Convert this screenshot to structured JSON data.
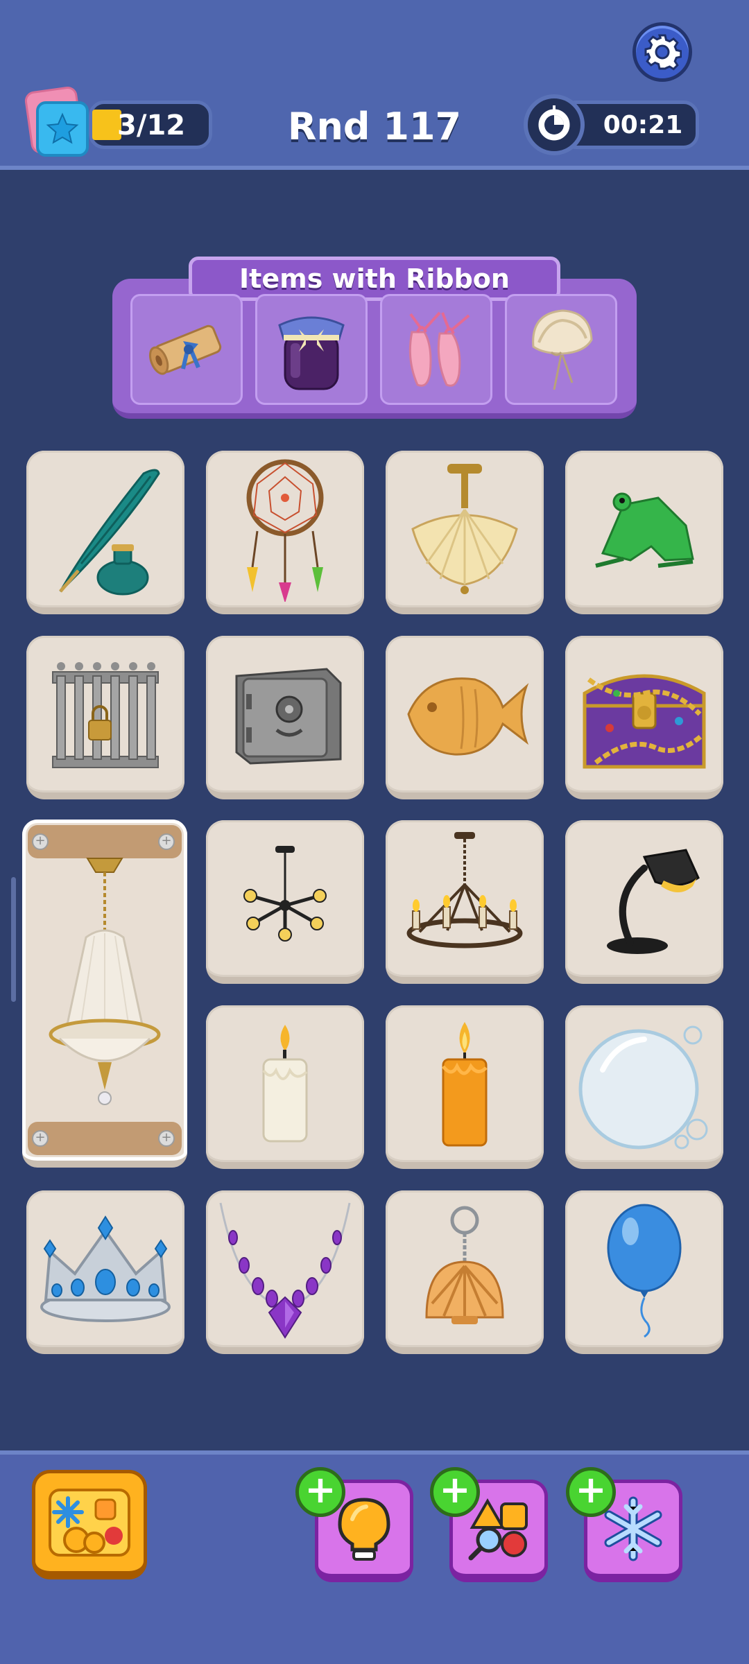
{
  "header": {
    "stars_progress": "3/12",
    "stars_fraction": 0.25,
    "round_title": "Rnd 117",
    "timer": "00:21"
  },
  "goal": {
    "title": "Items with Ribbon",
    "items": [
      "ribbon-scroll-icon",
      "jam-jar-icon",
      "ballet-shoes-icon",
      "bonnet-icon"
    ]
  },
  "board": {
    "tiles": [
      "quill-inkpot-icon",
      "dreamcatcher-icon",
      "ceiling-lamp-icon",
      "frog-icon",
      "iron-cage-icon",
      "safe-icon",
      "fish-cookie-icon",
      "treasure-chest-icon",
      "crystal-chandelier-icon",
      "modern-chandelier-icon",
      "iron-chandelier-icon",
      "desk-lamp-icon",
      "white-candle-icon",
      "orange-candle-icon",
      "soap-bubble-icon",
      "crown-icon",
      "amethyst-necklace-icon",
      "shell-keychain-icon",
      "blue-balloon-icon"
    ]
  },
  "boosters": [
    "collection-icon",
    "hint-bulb-icon",
    "shapes-icon",
    "freeze-icon"
  ],
  "colors": {
    "background": "#2f3f6c",
    "bar": "#4f66ae",
    "tile": "#e7ded4",
    "goal_panel": "#9666cf",
    "booster": "#d874ea",
    "plus": "#49d431"
  }
}
